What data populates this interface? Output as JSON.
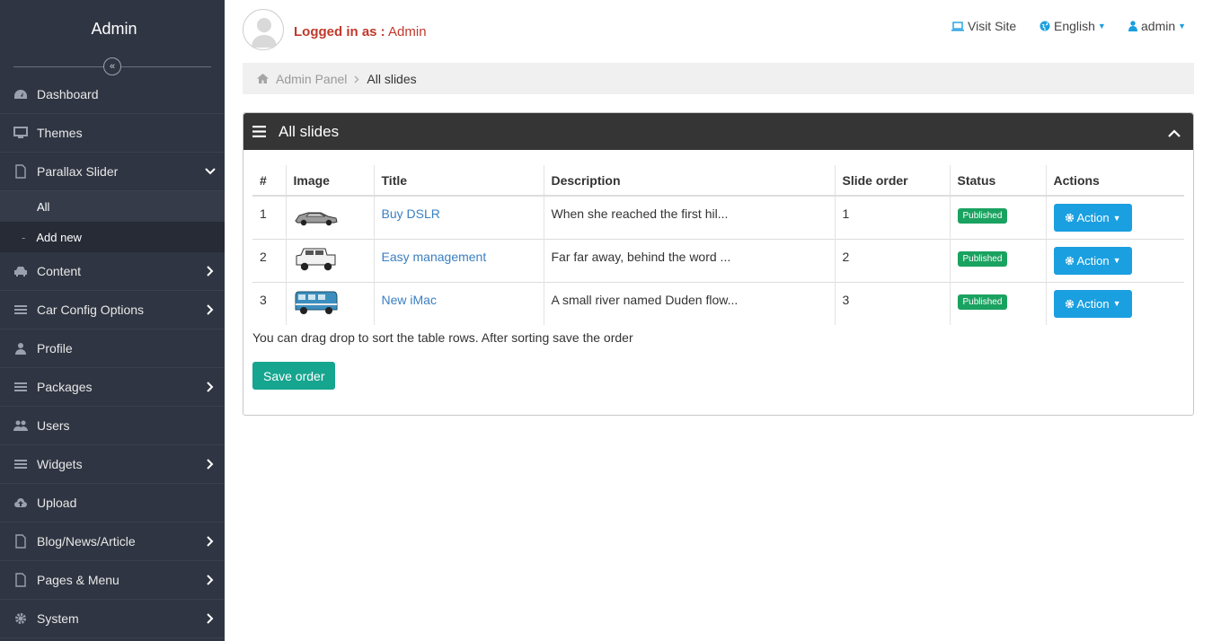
{
  "sidebar": {
    "brand": "Admin",
    "items": [
      {
        "label": "Dashboard",
        "icon": "dashboard-icon"
      },
      {
        "label": "Themes",
        "icon": "monitor-icon"
      },
      {
        "label": "Parallax Slider",
        "icon": "file-icon",
        "open": true
      },
      {
        "label": "Content",
        "icon": "car-icon"
      },
      {
        "label": "Car Config Options",
        "icon": "list-icon"
      },
      {
        "label": "Profile",
        "icon": "user-icon"
      },
      {
        "label": "Packages",
        "icon": "list-icon"
      },
      {
        "label": "Users",
        "icon": "users-icon"
      },
      {
        "label": "Widgets",
        "icon": "list-icon"
      },
      {
        "label": "Upload",
        "icon": "cloud-upload-icon"
      },
      {
        "label": "Blog/News/Article",
        "icon": "file-icon"
      },
      {
        "label": "Pages & Menu",
        "icon": "file-icon"
      },
      {
        "label": "System",
        "icon": "gear-icon"
      }
    ],
    "subitems": [
      {
        "label": "All"
      },
      {
        "label": "Add new"
      }
    ],
    "dash": "-"
  },
  "topbar": {
    "logged_prefix": "Logged in as :",
    "logged_user": "Admin",
    "visit_site": "Visit Site",
    "language": "English",
    "account": "admin"
  },
  "breadcrumb": {
    "root": "Admin Panel",
    "current": "All slides"
  },
  "panel": {
    "title": "All slides",
    "columns": [
      "#",
      "Image",
      "Title",
      "Description",
      "Slide order",
      "Status",
      "Actions"
    ],
    "rows": [
      {
        "num": "1",
        "image": "sedan-car-thumbnail",
        "title": "Buy DSLR",
        "description": "When she reached the first hil...",
        "order": "1",
        "status": "Published",
        "action": "Action"
      },
      {
        "num": "2",
        "image": "jeep-thumbnail",
        "title": "Easy management",
        "description": "Far far away, behind the word ...",
        "order": "2",
        "status": "Published",
        "action": "Action"
      },
      {
        "num": "3",
        "image": "van-thumbnail",
        "title": "New iMac",
        "description": "A small river named Duden flow...",
        "order": "3",
        "status": "Published",
        "action": "Action"
      }
    ],
    "hint": "You can drag drop to sort the table rows. After sorting save the order",
    "save_label": "Save order"
  },
  "colors": {
    "sidebar_bg": "#2f3542",
    "panel_head": "#353535",
    "action_blue": "#1a9fe0",
    "published_green": "#1aa260",
    "save_teal": "#16a58f",
    "logged_red": "#c0392b"
  }
}
